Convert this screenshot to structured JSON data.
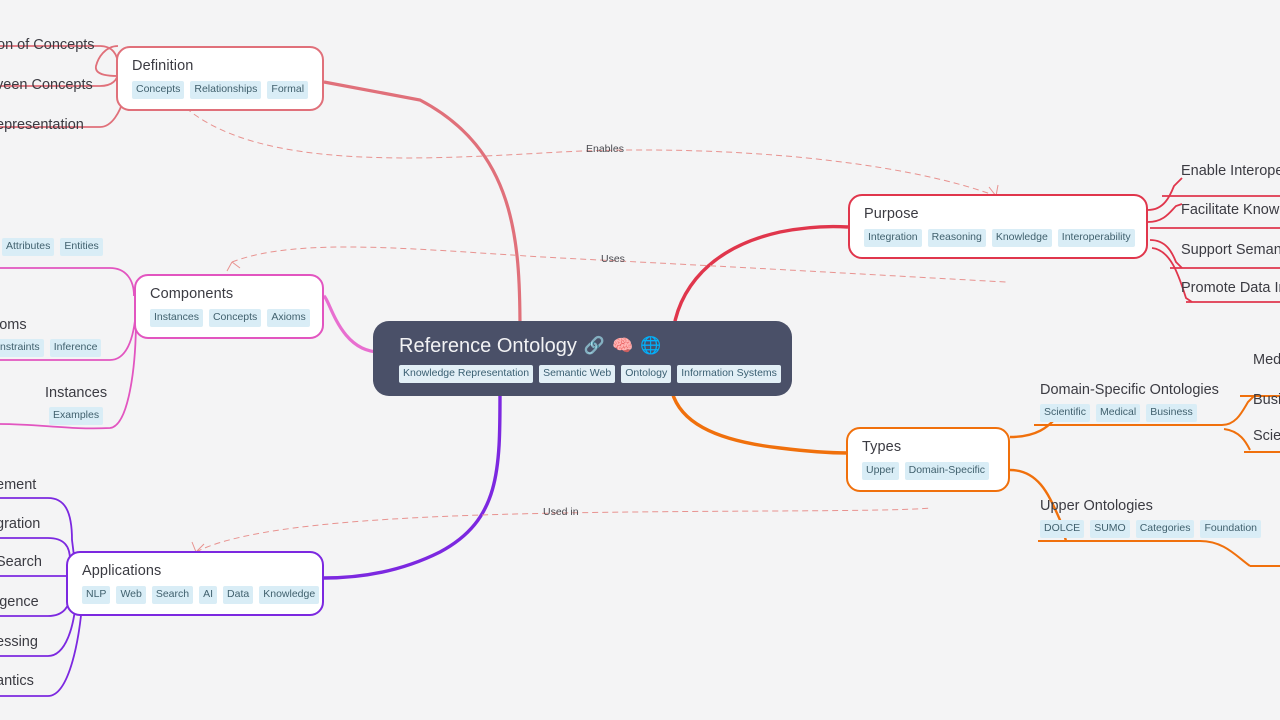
{
  "canvas": {
    "background": "#f4f4f5"
  },
  "central": {
    "title": "Reference Ontology",
    "icons": [
      "link-icon",
      "brain-icon",
      "globe-icon"
    ],
    "icon_glyphs": [
      "🔗",
      "🧠",
      "🌐"
    ],
    "color": "#4a5068",
    "tags": [
      "Knowledge Representation",
      "Semantic Web",
      "Ontology",
      "Information Systems"
    ]
  },
  "branches": [
    {
      "id": "definition",
      "title": "Definition",
      "color": "#e0707a",
      "tags": [
        "Concepts",
        "Relationships",
        "Formal"
      ],
      "children": [
        {
          "title": "on of Concepts",
          "tags": []
        },
        {
          "title": "veen Concepts",
          "tags": []
        },
        {
          "title": "epresentation",
          "tags": []
        }
      ]
    },
    {
      "id": "components",
      "title": "Components",
      "color": "#e255c0",
      "tags": [
        "Instances",
        "Concepts",
        "Axioms"
      ],
      "children": [
        {
          "title": "",
          "tags": [
            "Attributes",
            "Entities"
          ]
        },
        {
          "title": "ioms",
          "tags": [
            "nstraints",
            "Inference"
          ]
        },
        {
          "title": "Instances",
          "tags": [
            "Examples"
          ]
        }
      ]
    },
    {
      "id": "applications",
      "title": "Applications",
      "color": "#7c28e0",
      "tags": [
        "NLP",
        "Web",
        "Search",
        "AI",
        "Data",
        "Knowledge"
      ],
      "children": [
        {
          "title": "ement",
          "tags": []
        },
        {
          "title": "gration",
          "tags": []
        },
        {
          "title": "Search",
          "tags": []
        },
        {
          "title": "igence",
          "tags": []
        },
        {
          "title": "essing",
          "tags": []
        },
        {
          "title": "antics",
          "tags": []
        }
      ]
    },
    {
      "id": "purpose",
      "title": "Purpose",
      "color": "#e0364c",
      "tags": [
        "Integration",
        "Reasoning",
        "Knowledge",
        "Interoperability"
      ],
      "children": [
        {
          "title": "Enable Interoper",
          "tags": []
        },
        {
          "title": "Facilitate Knowle",
          "tags": []
        },
        {
          "title": "Support Semant",
          "tags": []
        },
        {
          "title": "Promote Data Int",
          "tags": []
        }
      ]
    },
    {
      "id": "types",
      "title": "Types",
      "color": "#f0700c",
      "tags": [
        "Upper",
        "Domain-Specific"
      ],
      "children": [
        {
          "title": "Domain-Specific Ontologies",
          "tags": [
            "Scientific",
            "Medical",
            "Business"
          ]
        },
        {
          "title": "Upper Ontologies",
          "tags": [
            "DOLCE",
            "SUMO",
            "Categories",
            "Foundation"
          ]
        }
      ],
      "grandchildren": [
        {
          "title": "Med"
        },
        {
          "title": "Busi"
        },
        {
          "title": "Scie"
        }
      ]
    }
  ],
  "connections": [
    {
      "label": "Enables",
      "from": "definition",
      "to": "purpose"
    },
    {
      "label": "Uses",
      "from": "components",
      "to": "purpose"
    },
    {
      "label": "Used in",
      "from": "applications",
      "to": "types"
    }
  ]
}
